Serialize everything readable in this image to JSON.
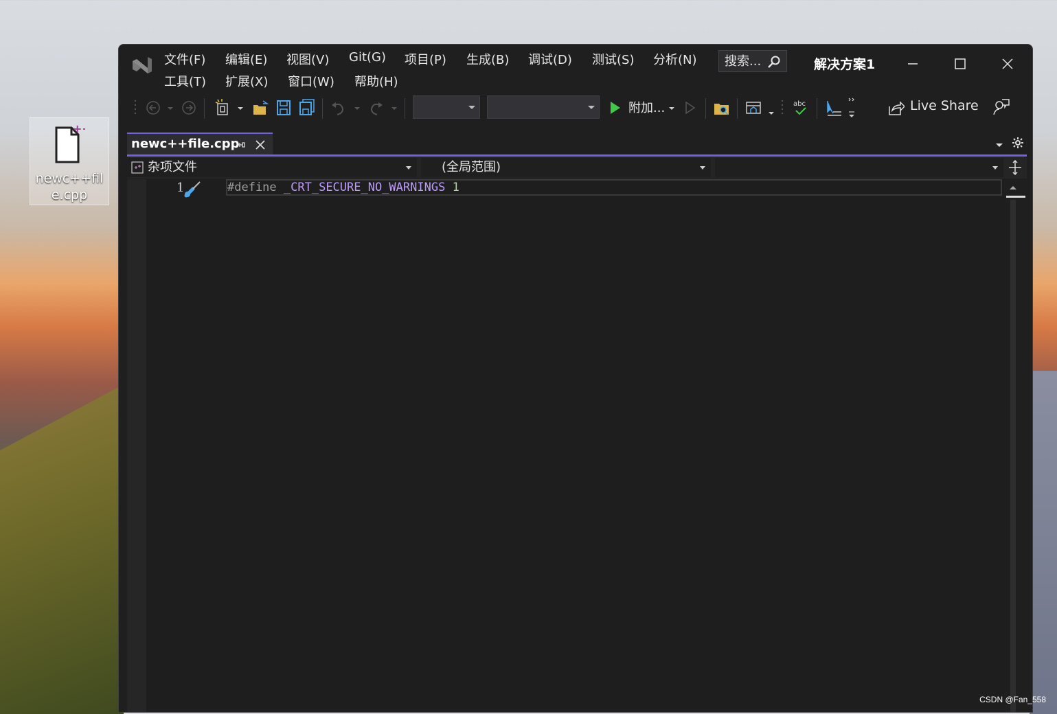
{
  "desktop": {
    "file_icon_label": "newc++file.cpp",
    "watermark": "CSDN @Fan_558"
  },
  "window": {
    "menu_row1": [
      "文件(F)",
      "编辑(E)",
      "视图(V)",
      "Git(G)",
      "项目(P)",
      "生成(B)",
      "调试(D)",
      "测试(S)",
      "分析(N)"
    ],
    "menu_row2": [
      "工具(T)",
      "扩展(X)",
      "窗口(W)",
      "帮助(H)"
    ],
    "search_placeholder": "搜索...",
    "solution_title": "解决方案1"
  },
  "toolbar": {
    "attach_label": "附加...",
    "live_share_label": "Live Share"
  },
  "tabs": [
    {
      "name": "newc++file.cpp",
      "active": true
    }
  ],
  "navbar": {
    "project_scope": "杂项文件",
    "scope": "(全局范围)",
    "member": ""
  },
  "editor": {
    "line_number": "1",
    "code": {
      "directive": "#define",
      "macro": "_CRT_SECURE_NO_WARNINGS",
      "value": "1"
    }
  },
  "colors": {
    "accent": "#7160e8",
    "window_bg": "#1f1f1f",
    "editor_bg": "#1e1e1e",
    "macro": "#bd9bf7",
    "number": "#b5cea8"
  }
}
